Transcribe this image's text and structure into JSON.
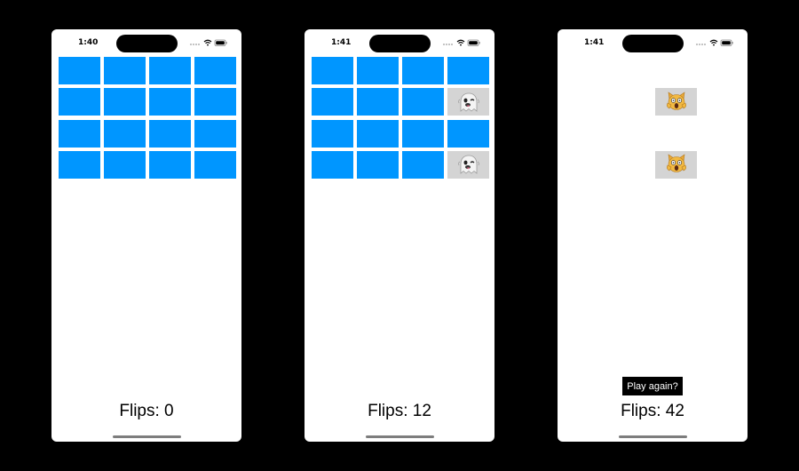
{
  "colors": {
    "card_back": "#0096ff",
    "card_face": "#d4d4d4",
    "button_bg": "#000000",
    "button_text": "#ffffff"
  },
  "screens": [
    {
      "time": "1:40",
      "flips_label": "Flips: 0",
      "cards": [
        "down",
        "down",
        "down",
        "down",
        "down",
        "down",
        "down",
        "down",
        "down",
        "down",
        "down",
        "down",
        "down",
        "down",
        "down",
        "down"
      ],
      "face_icon": "ghost-icon",
      "play_again_label": ""
    },
    {
      "time": "1:41",
      "flips_label": "Flips: 12",
      "cards": [
        "down",
        "down",
        "down",
        "down",
        "down",
        "down",
        "down",
        "up",
        "down",
        "down",
        "down",
        "down",
        "down",
        "down",
        "down",
        "up"
      ],
      "face_icon": "ghost-icon",
      "play_again_label": ""
    },
    {
      "time": "1:41",
      "flips_label": "Flips: 42",
      "cards": [
        "matched",
        "matched",
        "matched",
        "matched",
        "matched",
        "matched",
        "up",
        "matched",
        "matched",
        "matched",
        "matched",
        "matched",
        "matched",
        "matched",
        "up",
        "matched"
      ],
      "face_icon": "scared-cat-icon",
      "play_again_label": "Play again?"
    }
  ]
}
